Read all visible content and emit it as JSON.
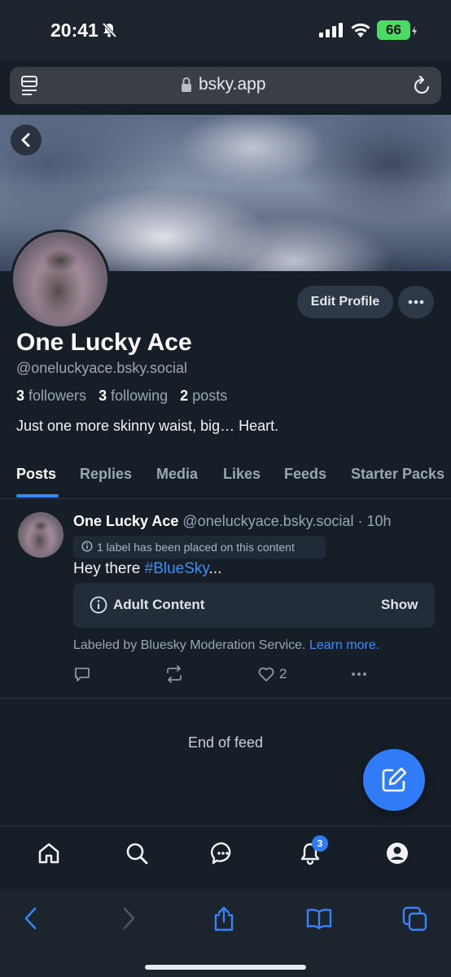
{
  "status_bar": {
    "time": "20:41",
    "battery": "66"
  },
  "browser": {
    "url": "bsky.app"
  },
  "profile": {
    "display_name": "One Lucky Ace",
    "handle": "@oneluckyace.bsky.social",
    "followers_count": "3",
    "followers_label": "followers",
    "following_count": "3",
    "following_label": "following",
    "posts_count": "2",
    "posts_label": "posts",
    "bio": "Just one more skinny waist, big…   Heart.",
    "edit_button": "Edit Profile"
  },
  "tabs": [
    {
      "label": "Posts",
      "active": true
    },
    {
      "label": "Replies",
      "active": false
    },
    {
      "label": "Media",
      "active": false
    },
    {
      "label": "Likes",
      "active": false
    },
    {
      "label": "Feeds",
      "active": false
    },
    {
      "label": "Starter Packs",
      "active": false
    }
  ],
  "post": {
    "author_name": "One Lucky Ace",
    "author_handle": "@oneluckyace.bsky.social",
    "separator": "·",
    "time": "10h",
    "label_notice": "1 label has been placed on this content",
    "text_prefix": "Hey there ",
    "hashtag": "#BlueSky",
    "text_suffix": "...",
    "content_warning": "Adult Content",
    "show_label": "Show",
    "moderation_note": "Labeled by Bluesky Moderation Service.",
    "learn_more": "Learn more.",
    "like_count": "2"
  },
  "feed": {
    "end_label": "End of feed"
  },
  "nav": {
    "notification_badge": "3"
  },
  "colors": {
    "background": "#161e27",
    "accent": "#2f7cf6",
    "link": "#3b8ff7",
    "muted_text": "#9aa6b4"
  },
  "icons": [
    "bell-slash-icon",
    "signal-icon",
    "wifi-icon",
    "battery-icon",
    "tabs-menu-icon",
    "lock-icon",
    "reload-icon",
    "back-icon",
    "more-icon",
    "info-icon",
    "reply-icon",
    "repost-icon",
    "like-icon",
    "compose-icon",
    "home-icon",
    "search-icon",
    "chat-icon",
    "notifications-icon",
    "profile-icon",
    "safari-back-icon",
    "safari-forward-icon",
    "share-icon",
    "bookmarks-icon",
    "tabs-icon"
  ]
}
